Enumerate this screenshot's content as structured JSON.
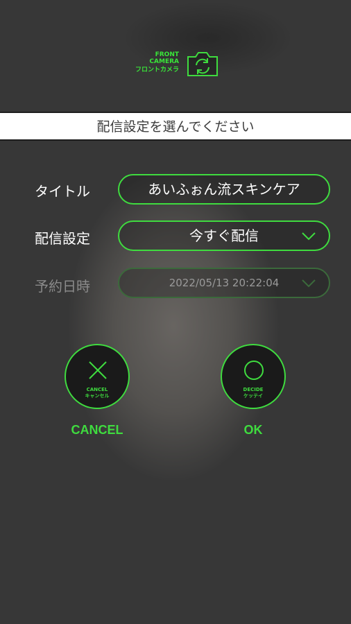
{
  "camera": {
    "label_en_1": "FRONT",
    "label_en_2": "CAMERA",
    "label_jp": "フロントカメラ",
    "icon": "camera-switch-icon"
  },
  "header": {
    "title": "配信設定を選んでください"
  },
  "form": {
    "title_label": "タイトル",
    "title_value": "あいふぉん流スキンケア",
    "setting_label": "配信設定",
    "setting_value": "今すぐ配信",
    "schedule_label": "予約日時",
    "schedule_value": "2022/05/13 20:22:04"
  },
  "actions": {
    "cancel": {
      "en": "CANCEL",
      "jp": "キャンセル",
      "caption": "CANCEL",
      "icon": "close-icon"
    },
    "decide": {
      "en": "DECIDE",
      "jp": "ケッテイ",
      "caption": "OK",
      "icon": "circle-icon"
    }
  },
  "colors": {
    "accent": "#3fdc3f",
    "header_bg": "#ffffff",
    "overlay": "#404040"
  }
}
